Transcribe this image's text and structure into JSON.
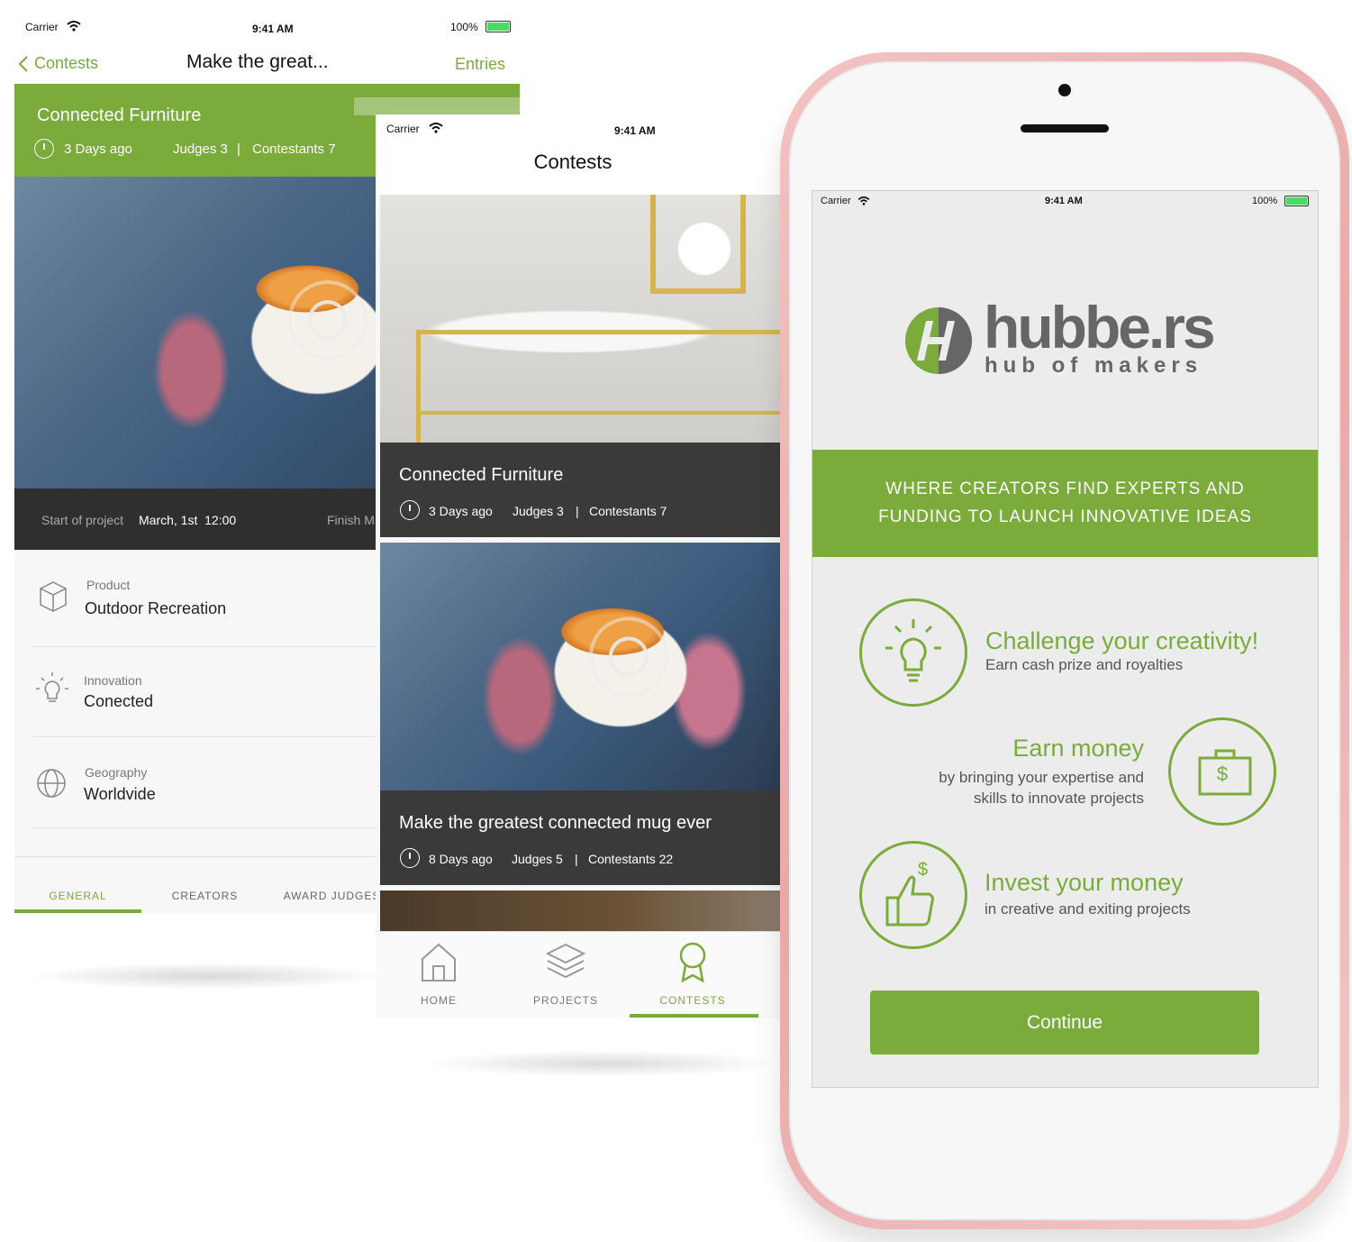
{
  "status": {
    "carrier": "Carrier",
    "time": "9:41 AM",
    "battery": "100%"
  },
  "detail": {
    "back_label": "Contests",
    "title": "Make the great...",
    "entries_label": "Entries",
    "head_title": "Connected Furniture",
    "head_days": "3 Days ago",
    "head_judges": "Judges 3",
    "head_sep": "|",
    "head_contestants": "Contestants 7",
    "start_label": "Start of project",
    "start_value": "March, 1st  12:00",
    "finish_label": "Finish M",
    "rows": [
      {
        "label": "Product",
        "value": "Outdoor Recreation"
      },
      {
        "label": "Innovation",
        "value": "Conected"
      },
      {
        "label": "Geography",
        "value": "Worldvide"
      }
    ],
    "tabs": [
      "GENERAL",
      "CREATORS",
      "AWARD JUDGES"
    ]
  },
  "list": {
    "title": "Contests",
    "cards": [
      {
        "title": "Connected Furniture",
        "days": "3 Days ago",
        "judges": "Judges 3",
        "sep": "|",
        "contestants": "Contestants 7"
      },
      {
        "title": "Make the greatest connected mug ever",
        "days": "8 Days ago",
        "judges": "Judges 5",
        "sep": "|",
        "contestants": "Contestants 22"
      }
    ],
    "tabbar": [
      "HOME",
      "PROJECTS",
      "CONTESTS"
    ]
  },
  "splash": {
    "logo_main": "hubbe.rs",
    "logo_sub": "hub of makers",
    "banner_line1": "WHERE CREATORS FIND EXPERTS AND",
    "banner_line2": "FUNDING TO LAUNCH INNOVATIVE IDEAS",
    "features": [
      {
        "title": "Challenge your creativity!",
        "sub": "Earn cash prize and royalties",
        "icon": "lightbulb-icon"
      },
      {
        "title": "Earn money",
        "sub1": "by bringing your expertise and",
        "sub2": "skills to innovate projects",
        "icon": "briefcase-dollar-icon"
      },
      {
        "title": "Invest your money",
        "sub": "in creative and exiting projects",
        "icon": "thumbs-up-dollar-icon"
      }
    ],
    "continue_label": "Continue",
    "dollar_glyph": "$"
  },
  "colors": {
    "accent": "#7aab3b",
    "dark_card": "#3a3a3a",
    "phone_frame": "#efb7b8"
  }
}
